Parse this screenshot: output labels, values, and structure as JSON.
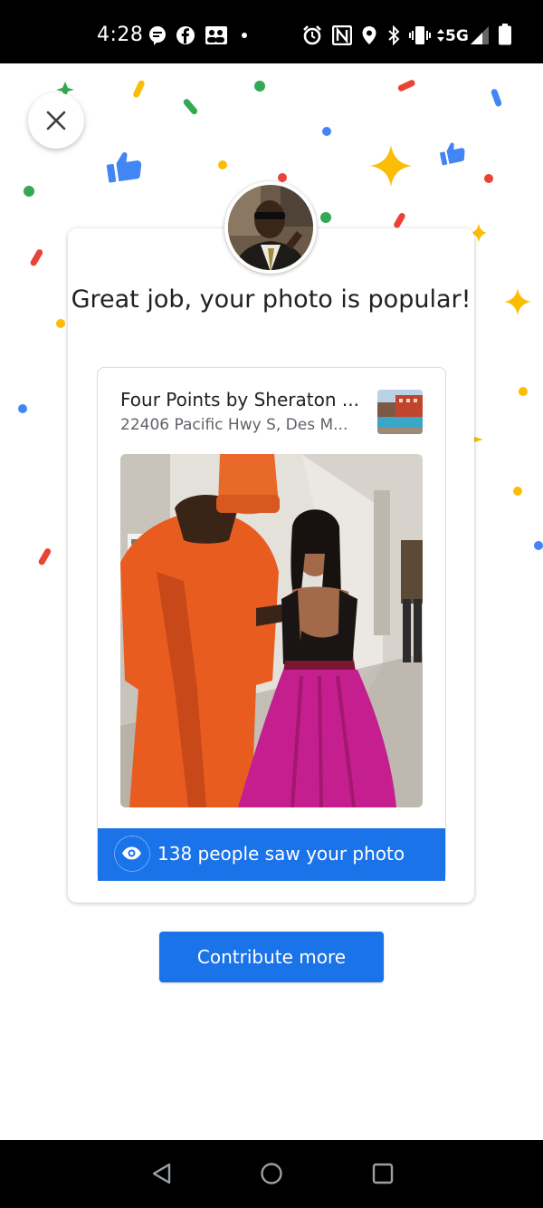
{
  "status_bar": {
    "time": "4:28",
    "network": "5G",
    "icons": [
      "message-icon",
      "facebook-icon",
      "contacts-icon",
      "dot-icon",
      "alarm-icon",
      "nfc-icon",
      "location-icon",
      "bluetooth-icon",
      "vibrate-icon",
      "data-arrows-icon",
      "signal-icon",
      "battery-icon"
    ]
  },
  "dialog": {
    "close_icon": "close-icon",
    "headline": "Great job, your photo is popular!",
    "place": {
      "name": "Four Points by Sheraton ...",
      "address": "22406 Pacific Hwy S, Des M..."
    },
    "views": {
      "icon": "eye-icon",
      "text": "138 people saw your photo"
    }
  },
  "cta": {
    "label": "Contribute more"
  },
  "nav_bar": {
    "icons": [
      "back-icon",
      "home-icon",
      "recents-icon"
    ]
  },
  "colors": {
    "accent": "#1a73e8",
    "confetti_blue": "#4285f4",
    "confetti_red": "#ea4335",
    "confetti_yellow": "#fbbc04",
    "confetti_green": "#34a853"
  }
}
